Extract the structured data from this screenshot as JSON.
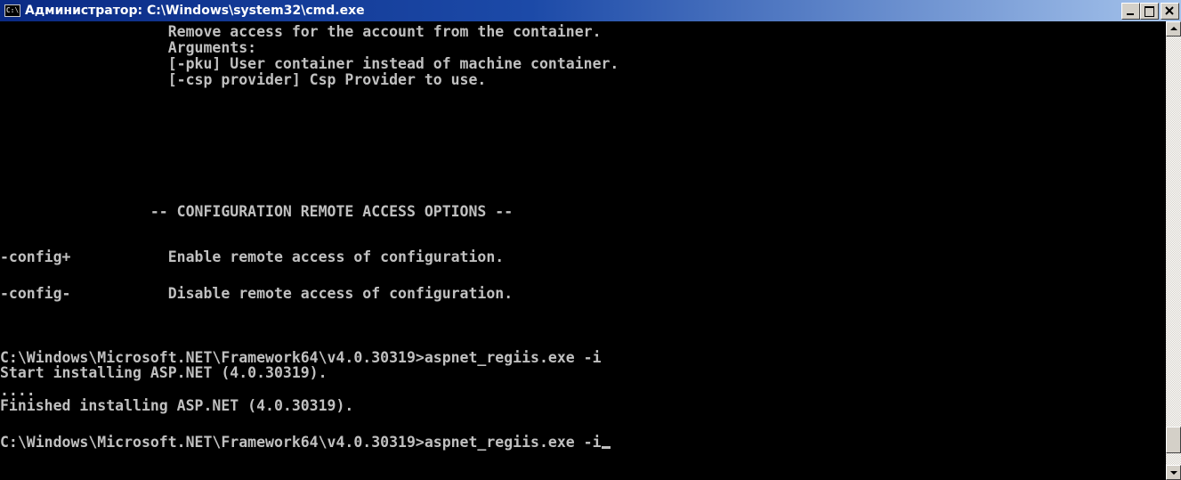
{
  "window": {
    "title": "Администратор: C:\\Windows\\system32\\cmd.exe",
    "icon_label": "C:\\",
    "icon": "console-app-icon"
  },
  "caption_buttons": {
    "minimize_icon": "minimize-icon",
    "maximize_icon": "maximize-icon",
    "close_icon": "close-icon"
  },
  "console": {
    "foreground": "#c0c0c0",
    "background": "#000000",
    "lines": [
      "                   Remove access for the account from the container.",
      "                   Arguments:",
      "                   [-pku] User container instead of machine container.",
      "                   [-csp provider] Csp Provider to use.",
      "",
      "",
      "",
      "                 -- CONFIGURATION REMOTE ACCESS OPTIONS --",
      "",
      "-config+           Enable remote access of configuration.",
      "",
      "-config-           Disable remote access of configuration.",
      "",
      "",
      "C:\\Windows\\Microsoft.NET\\Framework64\\v4.0.30319>aspnet_regiis.exe -i",
      "Start installing ASP.NET (4.0.30319).",
      "....",
      "Finished installing ASP.NET (4.0.30319).",
      "",
      "C:\\Windows\\Microsoft.NET\\Framework64\\v4.0.30319>aspnet_regiis.exe -i"
    ]
  },
  "scrollbar": {
    "up_icon": "scroll-up-arrow-icon",
    "down_icon": "scroll-down-arrow-icon",
    "position_fraction": 0.95
  }
}
